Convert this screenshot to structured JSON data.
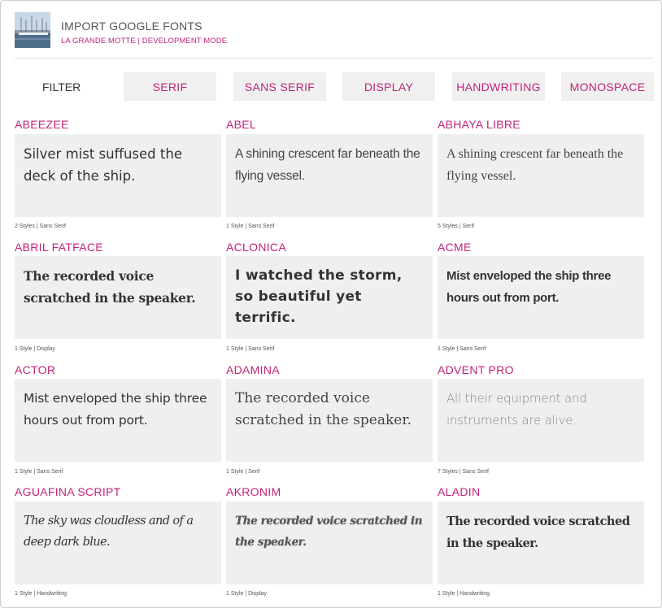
{
  "header": {
    "title": "IMPORT GOOGLE FONTS",
    "subtitle": "LA GRANDE MOTTE | DEVELOPMENT MODE"
  },
  "filter": {
    "label": "FILTER",
    "buttons": [
      "SERIF",
      "SANS SERIF",
      "DISPLAY",
      "HANDWRITING",
      "MONOSPACE"
    ]
  },
  "fonts": [
    {
      "name": "ABEEZEE",
      "sample": "Silver mist suffused the deck of the ship.",
      "meta": "2 Styles | Sans Serif"
    },
    {
      "name": "ABEL",
      "sample": "A shining crescent far beneath the flying vessel.",
      "meta": "1 Style | Sans Serif"
    },
    {
      "name": "ABHAYA LIBRE",
      "sample": "A shining crescent far beneath the flying vessel.",
      "meta": "5 Styles | Serif"
    },
    {
      "name": "ABRIL FATFACE",
      "sample": "The recorded voice scratched in the speaker.",
      "meta": "1 Style | Display"
    },
    {
      "name": "ACLONICA",
      "sample": "I watched the storm, so beautiful yet terrific.",
      "meta": "1 Style | Sans Serif"
    },
    {
      "name": "ACME",
      "sample": "Mist enveloped the ship three hours out from port.",
      "meta": "1 Style | Sans Serif"
    },
    {
      "name": "ACTOR",
      "sample": "Mist enveloped the ship three hours out from port.",
      "meta": "1 Style | Sans Serif"
    },
    {
      "name": "ADAMINA",
      "sample": "The recorded voice scratched in the speaker.",
      "meta": "1 Style | Serif"
    },
    {
      "name": "ADVENT PRO",
      "sample": "All their equipment and instruments are alive.",
      "meta": "7 Styles | Sans Serif"
    },
    {
      "name": "AGUAFINA SCRIPT",
      "sample": "The sky was cloudless and of a deep dark blue.",
      "meta": "1 Style | Handwriting"
    },
    {
      "name": "AKRONIM",
      "sample": "The recorded voice scratched in the speaker.",
      "meta": "1 Style | Display"
    },
    {
      "name": "ALADIN",
      "sample": "The recorded voice scratched in the speaker.",
      "meta": "1 Style | Handwriting"
    }
  ],
  "colors": {
    "accent": "#c2237a",
    "card_background": "#efefef",
    "button_background": "#f0f0f0",
    "text": "#333333"
  }
}
